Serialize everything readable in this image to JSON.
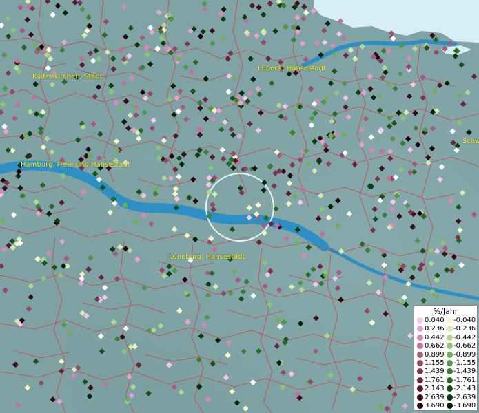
{
  "places": [
    {
      "name": "Kaltenkirchen, Stadt"
    },
    {
      "name": "Lübeck, Hansestadt"
    },
    {
      "name": "Hamburg, Freie und Hansestadt"
    },
    {
      "name": "Lüneburg, Hansestadt"
    },
    {
      "name": "Schw"
    }
  ],
  "colors": {
    "water": "#2d8fc4",
    "sea": "#d8eef6",
    "boundary": "#d43a3a",
    "label": "#f2ea1c"
  },
  "legend": {
    "title": "%/Jahr",
    "positive": [
      {
        "label": "0.040",
        "color": "#f7c6ec"
      },
      {
        "label": "0.236",
        "color": "#e8a2cf"
      },
      {
        "label": "0.442",
        "color": "#d888b6"
      },
      {
        "label": "0.662",
        "color": "#c0709a"
      },
      {
        "label": "0.899",
        "color": "#a85a7e"
      },
      {
        "label": "1.155",
        "color": "#934864"
      },
      {
        "label": "1.439",
        "color": "#7d354c"
      },
      {
        "label": "1.761",
        "color": "#682638"
      },
      {
        "label": "2.143",
        "color": "#541827"
      },
      {
        "label": "2.639",
        "color": "#3c0d18"
      },
      {
        "label": "3.690",
        "color": "#24040a"
      }
    ],
    "negative": [
      {
        "label": "-0.040",
        "color": "#f4f8c8"
      },
      {
        "label": "-0.236",
        "color": "#d4ecae"
      },
      {
        "label": "-0.442",
        "color": "#b0d990"
      },
      {
        "label": "-0.662",
        "color": "#8cc673"
      },
      {
        "label": "-0.899",
        "color": "#6db05a"
      },
      {
        "label": "-1.155",
        "color": "#519844"
      },
      {
        "label": "-1.439",
        "color": "#3a8032"
      },
      {
        "label": "-1.761",
        "color": "#276824"
      },
      {
        "label": "-2.143",
        "color": "#185218"
      },
      {
        "label": "-2.639",
        "color": "#0b3b0e"
      },
      {
        "label": "-3.690",
        "color": "#022405"
      }
    ]
  }
}
